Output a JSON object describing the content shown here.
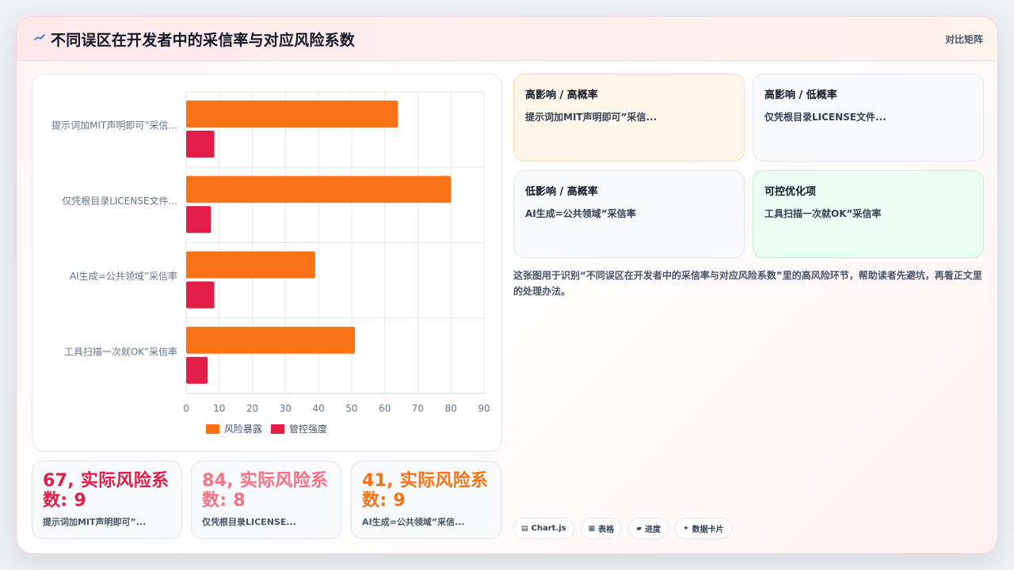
{
  "header": {
    "icon": "chart-line-icon",
    "title": "不同误区在开发者中的采信率与对应风险系数",
    "badge": "对比矩阵"
  },
  "colors": {
    "exposure": "#f97316",
    "control": "#e11d48",
    "stat_1": "#e11d48",
    "stat_2": "#f87185",
    "stat_3": "#f97316"
  },
  "chart_data": {
    "type": "bar",
    "orientation": "horizontal",
    "categories": [
      "提示词加MIT声明即可”采信...",
      "仅凭根目录LICENSE文件...",
      "AI生成=公共领域”采信率",
      "工具扫描一次就OK”采信率"
    ],
    "series": [
      {
        "name": "风险暴露",
        "values": [
          64,
          80,
          39,
          51
        ],
        "color": "#f97316"
      },
      {
        "name": "管控强度",
        "values": [
          8.5,
          7.5,
          8.5,
          6.5
        ],
        "color": "#e11d48"
      }
    ],
    "x_ticks": [
      "0",
      "10",
      "20",
      "30",
      "40",
      "50",
      "60",
      "70",
      "80",
      "90"
    ],
    "xlim": [
      0,
      90
    ],
    "grid": true,
    "legend_position": "bottom",
    "xlabel": "",
    "ylabel": "",
    "title": ""
  },
  "stats": [
    {
      "value": "67, 实际风险系数: 9",
      "label": "提示词加MIT声明即可”..."
    },
    {
      "value": "84, 实际风险系数: 8",
      "label": "仅凭根目录LICENSE..."
    },
    {
      "value": "41, 实际风险系数: 9",
      "label": "AI生成=公共领域”采信..."
    }
  ],
  "quadrants": [
    {
      "title": "高影响 / 高概率",
      "item": "提示词加MIT声明即可”采信..."
    },
    {
      "title": "高影响 / 低概率",
      "item": "仅凭根目录LICENSE文件..."
    },
    {
      "title": "低影响 / 高概率",
      "item": "AI生成=公共领域”采信率"
    },
    {
      "title": "可控优化项",
      "item": "工具扫描一次就OK”采信率"
    }
  ],
  "note": "这张图用于识别“不同误区在开发者中的采信率与对应风险系数”里的高风险环节，帮助读者先避坑，再看正文里的处理办法。",
  "tags": [
    {
      "icon": "chart-icon",
      "label": "Chart.js"
    },
    {
      "icon": "table-icon",
      "label": "表格"
    },
    {
      "icon": "progress-icon",
      "label": "进度"
    },
    {
      "icon": "sparkle-icon",
      "label": "数据卡片"
    }
  ]
}
